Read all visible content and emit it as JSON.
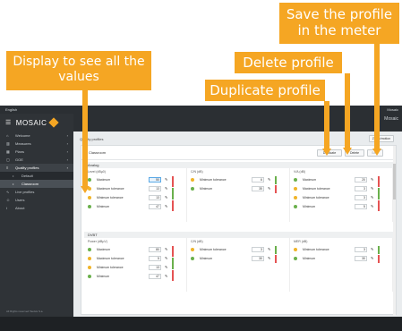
{
  "callouts": {
    "display": "Display to see all the values",
    "save": "Save the profile in the meter",
    "delete": "Delete profile",
    "duplicate": "Duplicate profile"
  },
  "topbar": {
    "left": "English",
    "right": "Mosaic"
  },
  "app": {
    "name": "MOSAIC"
  },
  "sidebar": {
    "items": [
      {
        "label": "Welcome",
        "icon": "home-icon"
      },
      {
        "label": "Measures",
        "icon": "chart-icon"
      },
      {
        "label": "Plans",
        "icon": "map-icon"
      },
      {
        "label": "GOE",
        "icon": "box-icon"
      },
      {
        "label": "Quality profiles",
        "icon": "sliders-icon"
      },
      {
        "label": "Default",
        "icon": "dot-icon"
      },
      {
        "label": "Classroom",
        "icon": "dot-icon"
      },
      {
        "label": "Live profiles",
        "icon": "pulse-icon"
      },
      {
        "label": "Users",
        "icon": "users-icon"
      },
      {
        "label": "About",
        "icon": "info-icon"
      }
    ],
    "copyright": "All Rights reserved Taelsis S.a."
  },
  "header": {
    "right": "Mosaic"
  },
  "content": {
    "breadcrumb": "Quality profiles",
    "card_title": "Classroom",
    "buttons": {
      "duplicate": "Duplicate",
      "delete": "Delete",
      "save": "Save",
      "zoom": "Zoom/motion"
    }
  },
  "colors": {
    "accent": "#f5a623",
    "good": "#6ab04c",
    "warn": "#f0b429",
    "bad": "#e55353"
  },
  "sections": [
    {
      "title": "Analog",
      "columns": [
        {
          "title": "Level (dBµ0)",
          "rows": [
            {
              "name": "Maximum",
              "value": "50",
              "status": "good",
              "selected": true
            },
            {
              "name": "Maximum tolerance",
              "value": "13",
              "status": "warn"
            },
            {
              "name": "Minimum tolerance",
              "value": "13",
              "status": "warn"
            },
            {
              "name": "Minimum",
              "value": "47",
              "status": "good"
            }
          ]
        },
        {
          "title": "C/N (dB)",
          "rows": [
            {
              "name": "Minimum tolerance",
              "value": "6",
              "status": "warn"
            },
            {
              "name": "Minimum",
              "value": "35",
              "status": "good"
            }
          ]
        },
        {
          "title": "V/A (dB)",
          "rows": [
            {
              "name": "Maximum",
              "value": "20",
              "status": "good"
            },
            {
              "name": "Maximum tolerance",
              "value": "3",
              "status": "warn"
            },
            {
              "name": "Minimum tolerance",
              "value": "3",
              "status": "warn"
            },
            {
              "name": "Minimum",
              "value": "5",
              "status": "good"
            }
          ]
        }
      ]
    },
    {
      "title": "DVBT",
      "columns": [
        {
          "title": "Power (dBµV)",
          "rows": [
            {
              "name": "Maximum",
              "value": "80",
              "status": "good"
            },
            {
              "name": "Maximum tolerance",
              "value": "5",
              "status": "warn"
            },
            {
              "name": "Minimum tolerance",
              "value": "13",
              "status": "warn"
            },
            {
              "name": "Minimum",
              "value": "47",
              "status": "good"
            }
          ]
        },
        {
          "title": "C/N (dB)",
          "rows": [
            {
              "name": "Minimum tolerance",
              "value": "3",
              "status": "warn"
            },
            {
              "name": "Minimum",
              "value": "30",
              "status": "good"
            }
          ]
        },
        {
          "title": "MER (dB)",
          "rows": [
            {
              "name": "Minimum tolerance",
              "value": "3",
              "status": "warn"
            },
            {
              "name": "Minimum",
              "value": "30",
              "status": "good"
            }
          ]
        }
      ]
    }
  ]
}
